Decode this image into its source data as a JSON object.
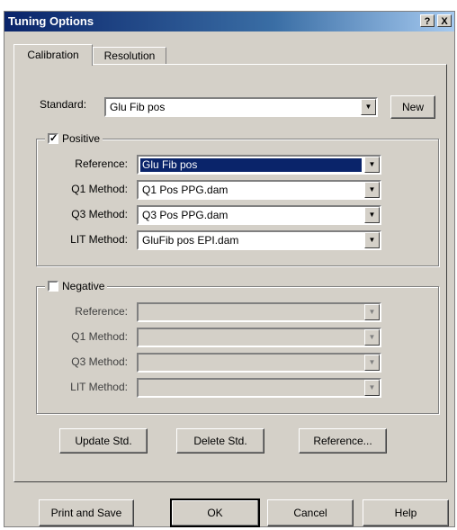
{
  "window": {
    "title": "Tuning Options",
    "help_btn": "?",
    "close_btn": "X"
  },
  "tabs": [
    {
      "label": "Calibration",
      "active": true
    },
    {
      "label": "Resolution",
      "active": false
    }
  ],
  "standard": {
    "label": "Standard:",
    "value": "Glu Fib pos",
    "new_button": "New"
  },
  "positive": {
    "label": "Positive",
    "checked": true,
    "checkmark": "✓",
    "fields": [
      {
        "label": "Reference:",
        "value": "Glu Fib pos"
      },
      {
        "label": "Q1 Method:",
        "value": "Q1 Pos PPG.dam"
      },
      {
        "label": "Q3 Method:",
        "value": "Q3 Pos PPG.dam"
      },
      {
        "label": "LIT Method:",
        "value": "GluFib pos EPI.dam"
      }
    ]
  },
  "negative": {
    "label": "Negative",
    "checked": false,
    "fields": [
      {
        "label": "Reference:",
        "value": ""
      },
      {
        "label": "Q1 Method:",
        "value": ""
      },
      {
        "label": "Q3 Method:",
        "value": ""
      },
      {
        "label": "LIT Method:",
        "value": ""
      }
    ]
  },
  "std_buttons": {
    "update": "Update Std.",
    "delete": "Delete Std.",
    "reference": "Reference..."
  },
  "bottom_buttons": {
    "print_save": "Print and Save",
    "ok": "OK",
    "cancel": "Cancel",
    "help": "Help"
  },
  "icons": {
    "dropdown_arrow": "▼"
  },
  "colors": {
    "titlebar": "#0a246a",
    "face": "#d4d0c8",
    "selection": "#0a246a"
  }
}
